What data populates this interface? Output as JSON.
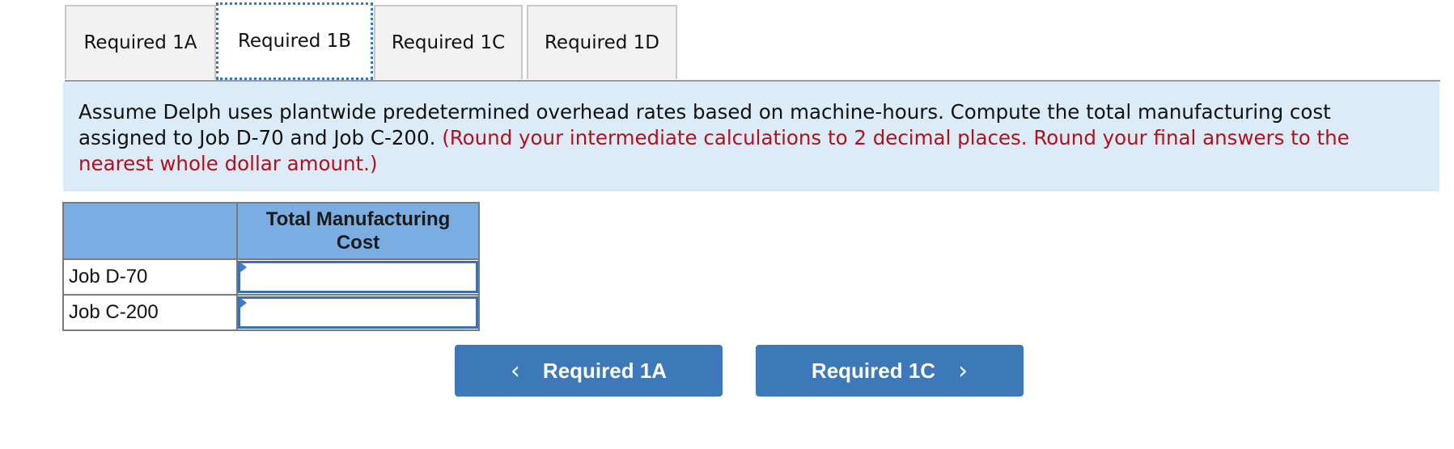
{
  "tabs": [
    {
      "label": "Required 1A",
      "active": false
    },
    {
      "label": "Required 1B",
      "active": true
    },
    {
      "label": "Required 1C",
      "active": false
    },
    {
      "label": "Required 1D",
      "active": false
    }
  ],
  "instructions": {
    "text": "Assume Delph uses plantwide predetermined overhead rates based on machine-hours. Compute the total manufacturing cost assigned to Job D-70 and Job C-200.",
    "note": "(Round your intermediate calculations to 2 decimal places. Round your final answers to the nearest whole dollar amount.)"
  },
  "table": {
    "header_blank": "",
    "column_header": "Total Manufacturing Cost",
    "rows": [
      {
        "label": "Job D-70",
        "value": ""
      },
      {
        "label": "Job C-200",
        "value": ""
      }
    ]
  },
  "navigation": {
    "prev_label": "Required 1A",
    "next_label": "Required 1C",
    "prev_icon": "chevron-left-icon",
    "next_icon": "chevron-right-icon"
  },
  "colors": {
    "accent": "#3d78b8",
    "instruction_bg": "#dcebf8",
    "note_red": "#b0121b",
    "table_header_bg": "#7aaee2"
  }
}
